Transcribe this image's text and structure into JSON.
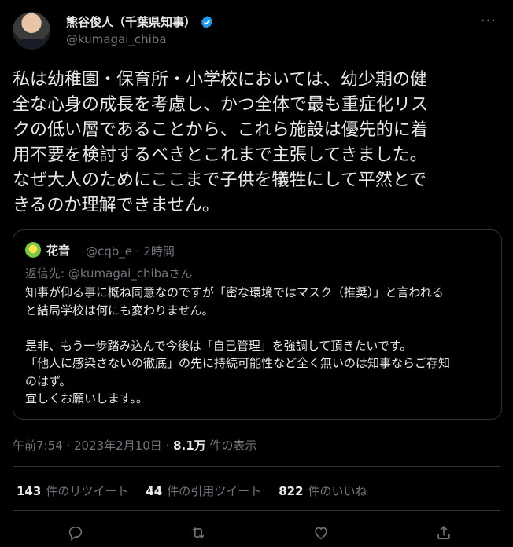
{
  "author": {
    "display_name": "熊谷俊人（千葉県知事）",
    "handle": "@kumagai_chiba",
    "verified_icon": "verified-badge-icon"
  },
  "tweet": {
    "text": "私は幼稚園・保育所・小学校においては、幼少期の健\n全な心身の成長を考慮し、かつ全体で最も重症化リス\nクの低い層であることから、これら施設は優先的に着\n用不要を検討するべきとこれまで主張してきました。\nなぜ大人のためにここまで子供を犠牲にして平然とで\nきるのか理解できません。"
  },
  "quote": {
    "name": "花音",
    "meta": "@cqb_e · 2時間",
    "reply_to": "返信先: @kumagai_chibaさん",
    "text": "知事が仰る事に概ね同意なのですが「密な環境ではマスク（推奨）」と言われる\nと結局学校は何にも変わりません。\n\n是非、もう一歩踏み込んで今後は「自己管理」を強調して頂きたいです。\n「他人に感染さないの徹底」の先に持続可能性など全く無いのは知事ならご存知\nのはず。\n宜しくお願いします。。"
  },
  "meta": {
    "time": "午前7:54 · 2023年2月10日 · ",
    "views": "8.1万",
    "views_label": " 件の表示"
  },
  "stats": [
    {
      "count": "143",
      "label": "件のリツイート"
    },
    {
      "count": "44",
      "label": "件の引用ツイート"
    },
    {
      "count": "822",
      "label": "件のいいね"
    }
  ],
  "colors": {
    "background": "#000000",
    "text": "#e7e9ea",
    "secondary": "#71767b",
    "border": "#2f3336",
    "verified": "#1d9bf0"
  }
}
